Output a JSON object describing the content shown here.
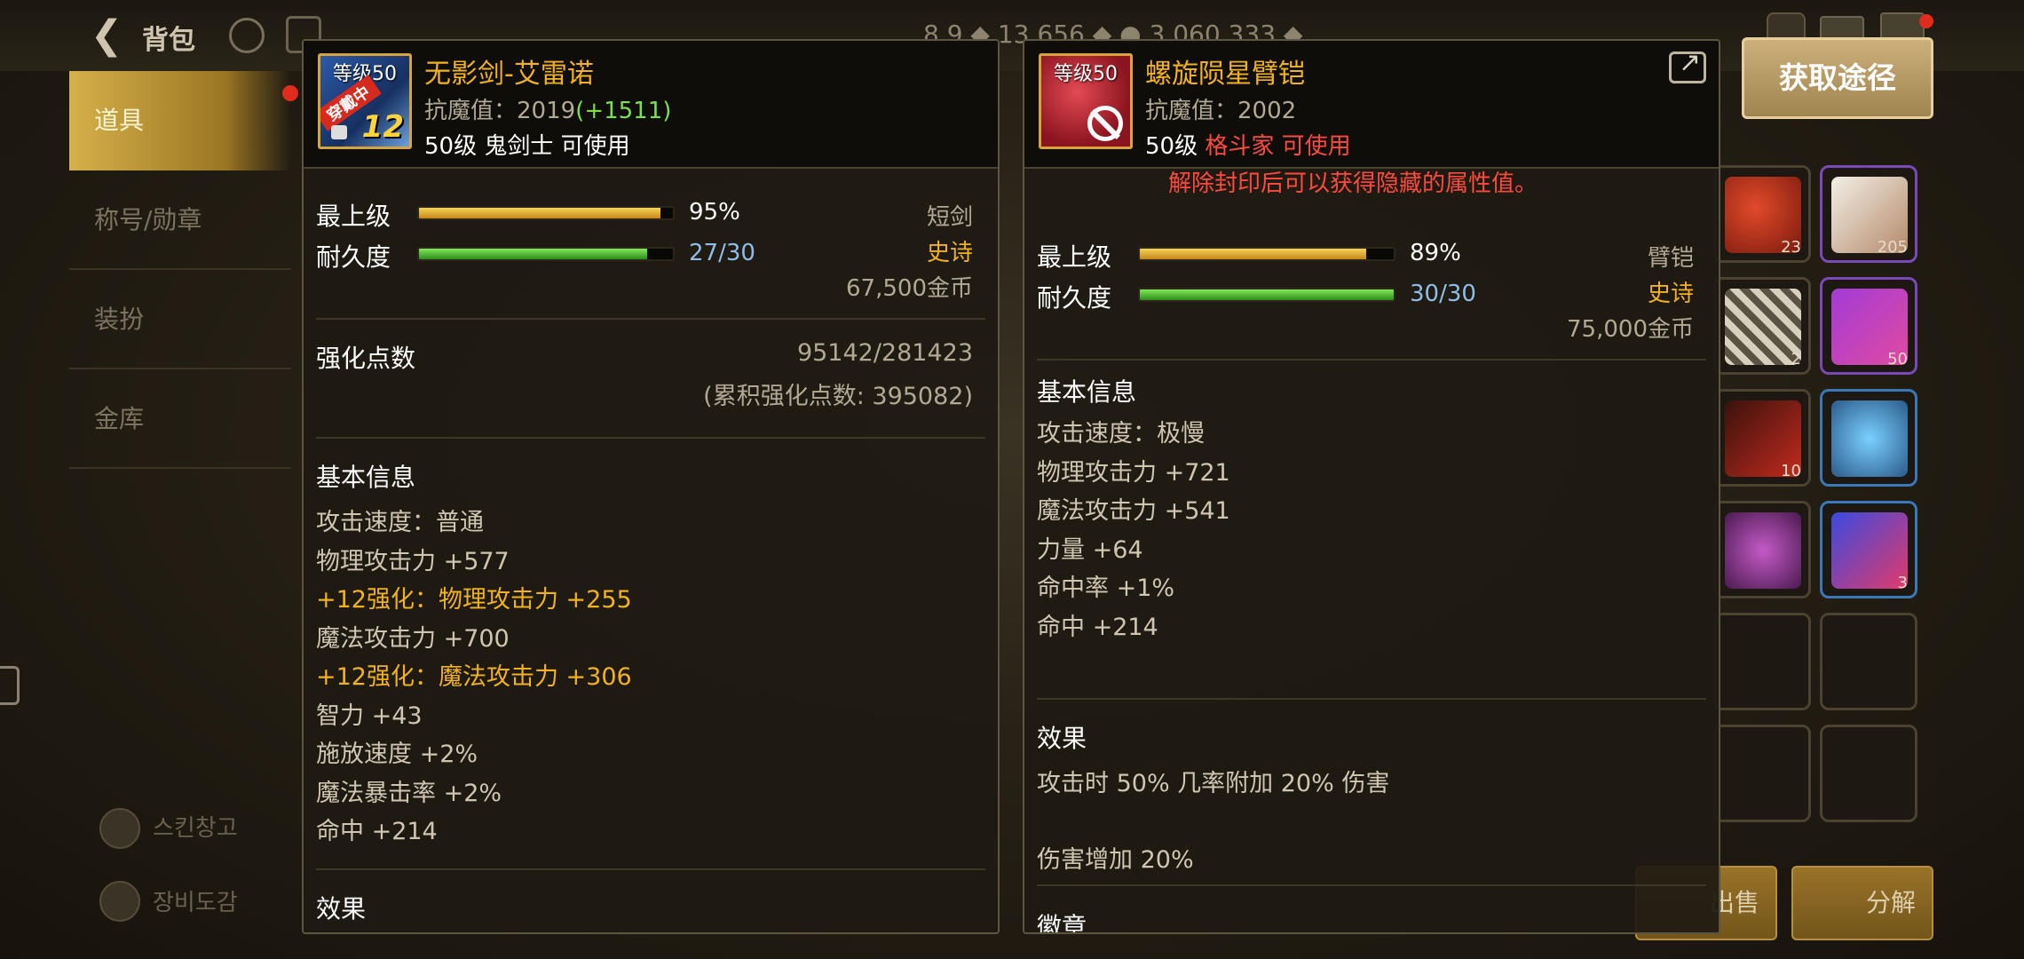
{
  "topbar": {
    "back_glyph": "❮",
    "title": "背包",
    "stats": "8 9   ◆  13,656 ◆   ●     3,060,333 ◆"
  },
  "left_menu": {
    "items": [
      {
        "label": "道具"
      },
      {
        "label": "称号/勋章"
      },
      {
        "label": "装扮"
      },
      {
        "label": "金库"
      }
    ],
    "bottom_1": "스킨창고",
    "bottom_2": "장비도감"
  },
  "acquire_button": "获取途径",
  "inventory": {
    "counts": [
      "23",
      "205",
      "2",
      "50",
      "10",
      "",
      "",
      "3"
    ]
  },
  "bottom_buttons": [
    "出售",
    "分解"
  ],
  "left_item": {
    "icon": {
      "level_text": "等级50",
      "equipped_text": "穿戴中",
      "plus_text": "12"
    },
    "name": "无影剑-艾雷诺",
    "resist_label": "抗魔值：2019",
    "resist_bonus": "(+1511)",
    "req_level": "50级",
    "req_class": "鬼剑士 可使用",
    "max_label": "最上级",
    "max_value": "95%",
    "max_pct": 95,
    "dur_label": "耐久度",
    "dur_value": "27/30",
    "dur_pct": 90,
    "type": "短剑",
    "rarity": "史诗",
    "price": "67,500金币",
    "enhance_label": "强化点数",
    "enhance_value": "95142/281423",
    "enhance_total": "(累积强化点数: 395082)",
    "basic_title": "基本信息",
    "stats": [
      {
        "text": "攻击速度：普通",
        "gold": false
      },
      {
        "text": "物理攻击力 +577",
        "gold": false
      },
      {
        "text": "+12强化：物理攻击力 +255",
        "gold": true
      },
      {
        "text": "魔法攻击力 +700",
        "gold": false
      },
      {
        "text": "+12强化：魔法攻击力 +306",
        "gold": true
      },
      {
        "text": "智力 +43",
        "gold": false
      },
      {
        "text": "施放速度 +2%",
        "gold": false
      },
      {
        "text": "魔法暴击率 +2%",
        "gold": false
      },
      {
        "text": "命中 +214",
        "gold": false
      }
    ],
    "effect_title": "效果"
  },
  "right_item": {
    "icon": {
      "level_text": "等级50"
    },
    "name": "螺旋陨星臂铠",
    "resist_label": "抗魔值：2002",
    "req_level": "50级",
    "req_class": "格斗家 可使用",
    "seal_note": "解除封印后可以获得隐藏的属性值。",
    "max_label": "最上级",
    "max_value": "89%",
    "max_pct": 89,
    "dur_label": "耐久度",
    "dur_value": "30/30",
    "dur_pct": 100,
    "type": "臂铠",
    "rarity": "史诗",
    "price": "75,000金币",
    "basic_title": "基本信息",
    "stats": [
      {
        "text": "攻击速度：极慢"
      },
      {
        "text": "物理攻击力 +721"
      },
      {
        "text": "魔法攻击力 +541"
      },
      {
        "text": "力量 +64"
      },
      {
        "text": "命中率 +1%"
      },
      {
        "text": "命中 +214"
      }
    ],
    "effect_title": "效果",
    "effects": [
      "攻击时 50% 几率附加 20% 伤害",
      "伤害增加 20%"
    ],
    "emblem_title": "徽章"
  }
}
